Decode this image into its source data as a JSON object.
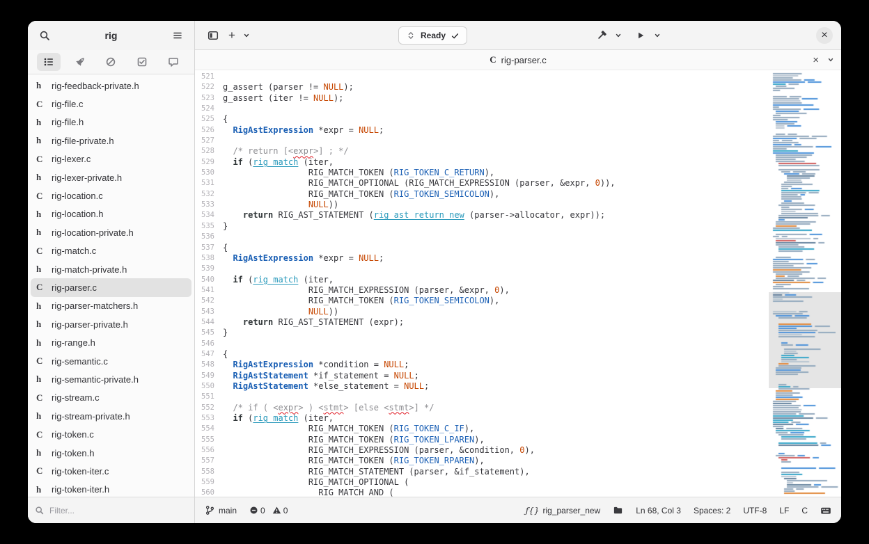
{
  "sidebar": {
    "title": "rig",
    "panel_tabs": [
      {
        "name": "list",
        "icon": "list",
        "active": true
      },
      {
        "name": "rocket",
        "icon": "rocket",
        "active": false
      },
      {
        "name": "prohibited",
        "icon": "circle-slash",
        "active": false
      },
      {
        "name": "checklist",
        "icon": "checklist",
        "active": false
      },
      {
        "name": "comments",
        "icon": "chat",
        "active": false
      }
    ],
    "files": [
      {
        "kind": "h",
        "name": "rig-feedback-private.h",
        "selected": false
      },
      {
        "kind": "C",
        "name": "rig-file.c",
        "selected": false
      },
      {
        "kind": "h",
        "name": "rig-file.h",
        "selected": false
      },
      {
        "kind": "h",
        "name": "rig-file-private.h",
        "selected": false
      },
      {
        "kind": "C",
        "name": "rig-lexer.c",
        "selected": false
      },
      {
        "kind": "h",
        "name": "rig-lexer-private.h",
        "selected": false
      },
      {
        "kind": "C",
        "name": "rig-location.c",
        "selected": false
      },
      {
        "kind": "h",
        "name": "rig-location.h",
        "selected": false
      },
      {
        "kind": "h",
        "name": "rig-location-private.h",
        "selected": false
      },
      {
        "kind": "C",
        "name": "rig-match.c",
        "selected": false
      },
      {
        "kind": "h",
        "name": "rig-match-private.h",
        "selected": false
      },
      {
        "kind": "C",
        "name": "rig-parser.c",
        "selected": true
      },
      {
        "kind": "h",
        "name": "rig-parser-matchers.h",
        "selected": false
      },
      {
        "kind": "h",
        "name": "rig-parser-private.h",
        "selected": false
      },
      {
        "kind": "h",
        "name": "rig-range.h",
        "selected": false
      },
      {
        "kind": "C",
        "name": "rig-semantic.c",
        "selected": false
      },
      {
        "kind": "h",
        "name": "rig-semantic-private.h",
        "selected": false
      },
      {
        "kind": "C",
        "name": "rig-stream.c",
        "selected": false
      },
      {
        "kind": "h",
        "name": "rig-stream-private.h",
        "selected": false
      },
      {
        "kind": "C",
        "name": "rig-token.c",
        "selected": false
      },
      {
        "kind": "h",
        "name": "rig-token.h",
        "selected": false
      },
      {
        "kind": "C",
        "name": "rig-token-iter.c",
        "selected": false
      },
      {
        "kind": "h",
        "name": "rig-token-iter.h",
        "selected": false
      }
    ],
    "filter_placeholder": "Filter..."
  },
  "header": {
    "new_tab_label": "+",
    "omnibar_label": "Ready"
  },
  "tab": {
    "language_badge": "C",
    "filename": "rig-parser.c"
  },
  "editor": {
    "first_line": 521,
    "lines": [
      [],
      [
        [
          "p",
          "g_assert (parser != "
        ],
        [
          "c",
          "NULL"
        ],
        [
          "p",
          ");"
        ]
      ],
      [
        [
          "p",
          "g_assert (iter != "
        ],
        [
          "c",
          "NULL"
        ],
        [
          "p",
          ");"
        ]
      ],
      [],
      [
        [
          "p",
          "{"
        ]
      ],
      [
        [
          "p",
          "  "
        ],
        [
          "t",
          "RigAstExpression"
        ],
        [
          "p",
          " *expr = "
        ],
        [
          "c",
          "NULL"
        ],
        [
          "p",
          ";"
        ]
      ],
      [],
      [
        [
          "cm",
          "  /* return [<"
        ],
        [
          "sp",
          "expr"
        ],
        [
          "cm",
          ">] ; */"
        ]
      ],
      [
        [
          "p",
          "  "
        ],
        [
          "k",
          "if"
        ],
        [
          "p",
          " ("
        ],
        [
          "f",
          "rig_match"
        ],
        [
          "p",
          " (iter,"
        ]
      ],
      [
        [
          "p",
          "                 RIG_MATCH_TOKEN ("
        ],
        [
          "e",
          "RIG_TOKEN_C_RETURN"
        ],
        [
          "p",
          "),"
        ]
      ],
      [
        [
          "p",
          "                 RIG_MATCH_OPTIONAL (RIG_MATCH_EXPRESSION (parser, &expr, "
        ],
        [
          "c",
          "0"
        ],
        [
          "p",
          ")),"
        ]
      ],
      [
        [
          "p",
          "                 RIG_MATCH_TOKEN ("
        ],
        [
          "e",
          "RIG_TOKEN_SEMICOLON"
        ],
        [
          "p",
          "),"
        ]
      ],
      [
        [
          "p",
          "                 "
        ],
        [
          "c",
          "NULL"
        ],
        [
          "p",
          "))"
        ]
      ],
      [
        [
          "p",
          "    "
        ],
        [
          "k",
          "return"
        ],
        [
          "p",
          " RIG_AST_STATEMENT ("
        ],
        [
          "f",
          "rig_ast_return_new"
        ],
        [
          "p",
          " (parser->allocator, expr));"
        ]
      ],
      [
        [
          "p",
          "}"
        ]
      ],
      [],
      [
        [
          "p",
          "{"
        ]
      ],
      [
        [
          "p",
          "  "
        ],
        [
          "t",
          "RigAstExpression"
        ],
        [
          "p",
          " *expr = "
        ],
        [
          "c",
          "NULL"
        ],
        [
          "p",
          ";"
        ]
      ],
      [],
      [
        [
          "p",
          "  "
        ],
        [
          "k",
          "if"
        ],
        [
          "p",
          " ("
        ],
        [
          "f",
          "rig_match"
        ],
        [
          "p",
          " (iter,"
        ]
      ],
      [
        [
          "p",
          "                 RIG_MATCH_EXPRESSION (parser, &expr, "
        ],
        [
          "c",
          "0"
        ],
        [
          "p",
          "),"
        ]
      ],
      [
        [
          "p",
          "                 RIG_MATCH_TOKEN ("
        ],
        [
          "e",
          "RIG_TOKEN_SEMICOLON"
        ],
        [
          "p",
          "),"
        ]
      ],
      [
        [
          "p",
          "                 "
        ],
        [
          "c",
          "NULL"
        ],
        [
          "p",
          "))"
        ]
      ],
      [
        [
          "p",
          "    "
        ],
        [
          "k",
          "return"
        ],
        [
          "p",
          " RIG_AST_STATEMENT (expr);"
        ]
      ],
      [
        [
          "p",
          "}"
        ]
      ],
      [],
      [
        [
          "p",
          "{"
        ]
      ],
      [
        [
          "p",
          "  "
        ],
        [
          "t",
          "RigAstExpression"
        ],
        [
          "p",
          " *condition = "
        ],
        [
          "c",
          "NULL"
        ],
        [
          "p",
          ";"
        ]
      ],
      [
        [
          "p",
          "  "
        ],
        [
          "t",
          "RigAstStatement"
        ],
        [
          "p",
          " *if_statement = "
        ],
        [
          "c",
          "NULL"
        ],
        [
          "p",
          ";"
        ]
      ],
      [
        [
          "p",
          "  "
        ],
        [
          "t",
          "RigAstStatement"
        ],
        [
          "p",
          " *else_statement = "
        ],
        [
          "c",
          "NULL"
        ],
        [
          "p",
          ";"
        ]
      ],
      [],
      [
        [
          "cm",
          "  /* if ( <"
        ],
        [
          "sp",
          "expr"
        ],
        [
          "cm",
          "> ) <"
        ],
        [
          "sp",
          "stmt"
        ],
        [
          "cm",
          "> [else <"
        ],
        [
          "sp",
          "stmt"
        ],
        [
          "cm",
          ">] */"
        ]
      ],
      [
        [
          "p",
          "  "
        ],
        [
          "k",
          "if"
        ],
        [
          "p",
          " ("
        ],
        [
          "f",
          "rig_match"
        ],
        [
          "p",
          " (iter,"
        ]
      ],
      [
        [
          "p",
          "                 RIG_MATCH_TOKEN ("
        ],
        [
          "e",
          "RIG_TOKEN_C_IF"
        ],
        [
          "p",
          "),"
        ]
      ],
      [
        [
          "p",
          "                 RIG_MATCH_TOKEN ("
        ],
        [
          "e",
          "RIG_TOKEN_LPAREN"
        ],
        [
          "p",
          "),"
        ]
      ],
      [
        [
          "p",
          "                 RIG_MATCH_EXPRESSION (parser, &condition, "
        ],
        [
          "c",
          "0"
        ],
        [
          "p",
          "),"
        ]
      ],
      [
        [
          "p",
          "                 RIG_MATCH_TOKEN ("
        ],
        [
          "e",
          "RIG_TOKEN_RPAREN"
        ],
        [
          "p",
          "),"
        ]
      ],
      [
        [
          "p",
          "                 RIG_MATCH_STATEMENT (parser, &if_statement),"
        ]
      ],
      [
        [
          "p",
          "                 RIG_MATCH_OPTIONAL ("
        ]
      ],
      [
        [
          "p",
          "                   RIG_MATCH_AND ("
        ]
      ]
    ]
  },
  "minimap": {
    "viewport_top_pct": 52,
    "viewport_height_pct": 22.5
  },
  "statusbar": {
    "branch": "main",
    "error_count": "0",
    "warning_count": "0",
    "symbol": "rig_parser_new",
    "cursor": "Ln 68, Col 3",
    "indentation": "Spaces: 2",
    "encoding": "UTF-8",
    "line_ending": "LF",
    "language": "C"
  }
}
